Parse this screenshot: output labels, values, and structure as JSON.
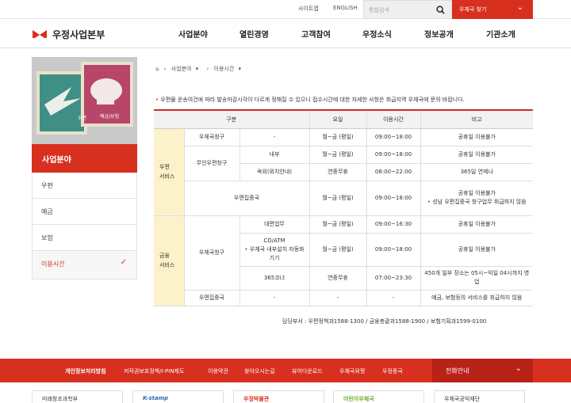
{
  "top": {
    "sitemap": "사이트맵",
    "english": "ENGLISH",
    "search_placeholder": "통합검색",
    "find_office": "우체국 찾기"
  },
  "header": {
    "brand": "KOREA POST",
    "title": "우정사업본부",
    "nav": [
      "사업분야",
      "열린경영",
      "고객참여",
      "우정소식",
      "정보공개",
      "기관소개"
    ]
  },
  "sidebar": {
    "title": "사업분야",
    "stamp_left": "우편",
    "stamp_right": "예금/보험",
    "items": [
      "우편",
      "예금",
      "보험",
      "이용시간"
    ],
    "active": "이용시간"
  },
  "breadcrumb": [
    "사업분야",
    "이용시간"
  ],
  "notice": "우편물 운송여건에 따라 발송마감시각이 다르게 정해질 수 있으니 접수시간에 대한 자세한 사항은 취급지역 우체국에 문의 바랍니다.",
  "table": {
    "headers": [
      "구분",
      "요일",
      "이용시간",
      "비고"
    ],
    "groups": {
      "postal": "우편\n서비스",
      "finance": "금융\n서비스"
    },
    "r1": {
      "a": "우체국창구",
      "b": "-",
      "day": "월~금 (평일)",
      "time": "09:00~18:00",
      "note": "공휴일 이용불가"
    },
    "r2": {
      "a": "무인우편창구",
      "b": "내부",
      "day": "월~금 (평일)",
      "time": "09:00~18:00",
      "note": "공휴일 이용불가"
    },
    "r3": {
      "b": "옥외(위치안내)",
      "day": "연중무휴",
      "time": "08:00~22:00",
      "note": "365일 연제나"
    },
    "r4": {
      "a": "우편집중국",
      "day": "월~금 (평일)",
      "time": "09:00~18:00",
      "note1": "공휴일 이용불가",
      "note2": "성남 우편집중국 창구업무 취급하지 않음"
    },
    "r5": {
      "a": "우체국창구",
      "b": "대면업무",
      "day": "월~금 (평일)",
      "time": "09:00~16:30",
      "note": "공휴일 이용불가"
    },
    "r6": {
      "b1": "CD/ATM",
      "b2": "우체국 내부설치 자동화기기",
      "day": "월~금 (평일)",
      "time": "09:00~18:00",
      "note": "공휴일 이용불가"
    },
    "r7": {
      "b": "365코너",
      "day": "연중무휴",
      "time": "07:00~23:30",
      "note": "450개 일부 장소는 05시~익일 04시까지 영업"
    },
    "r8": {
      "a": "우편집중국",
      "b": "-",
      "day": "-",
      "time": "-",
      "note": "예금, 보험등의 서비스를 취급하지 않음"
    }
  },
  "contact": "담당부서 : 우편정책과1588-1300  /  금융총괄과1588-1900  /  보험기획과1599-0100",
  "footer": {
    "links": [
      "개인정보처리방침",
      "저작권보호정책/I-PIN제도",
      "이용약관",
      "찾아오시는길",
      "뷰어다운로드",
      "우체국위젯",
      "우정종국"
    ],
    "welfare": "전화안내"
  },
  "banners": [
    "미래창조과학부",
    "K-stamp",
    "우정박물관",
    "어린이우체국",
    "우체국공익재단"
  ],
  "colors": {
    "accent": "#d7301f",
    "group_bg": "#fbf2c9"
  }
}
